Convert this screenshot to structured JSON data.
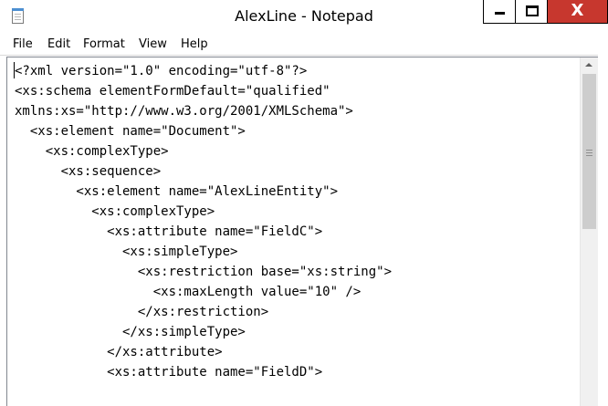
{
  "window": {
    "title": "AlexLine - Notepad",
    "icon": "notepad-icon",
    "controls": {
      "minimize_icon": "minimize-icon",
      "maximize_icon": "maximize-icon",
      "close_icon": "close-icon",
      "close_glyph": "X",
      "close_color": "#c7372e"
    }
  },
  "menu": {
    "items": [
      "File",
      "Edit",
      "Format",
      "View",
      "Help"
    ]
  },
  "editor": {
    "lines": [
      "<?xml version=\"1.0\" encoding=\"utf-8\"?>",
      "<xs:schema elementFormDefault=\"qualified\"",
      "xmlns:xs=\"http://www.w3.org/2001/XMLSchema\">",
      "  <xs:element name=\"Document\">",
      "    <xs:complexType>",
      "      <xs:sequence>",
      "        <xs:element name=\"AlexLineEntity\">",
      "          <xs:complexType>",
      "            <xs:attribute name=\"FieldC\">",
      "              <xs:simpleType>",
      "                <xs:restriction base=\"xs:string\">",
      "                  <xs:maxLength value=\"10\" />",
      "                </xs:restriction>",
      "              </xs:simpleType>",
      "            </xs:attribute>",
      "            <xs:attribute name=\"FieldD\">"
    ]
  },
  "scrollbar": {
    "up_icon": "chevron-up-icon",
    "thumb_grip_icon": "grip-icon",
    "position_fraction": 0.0,
    "visible_fraction": 0.47
  }
}
